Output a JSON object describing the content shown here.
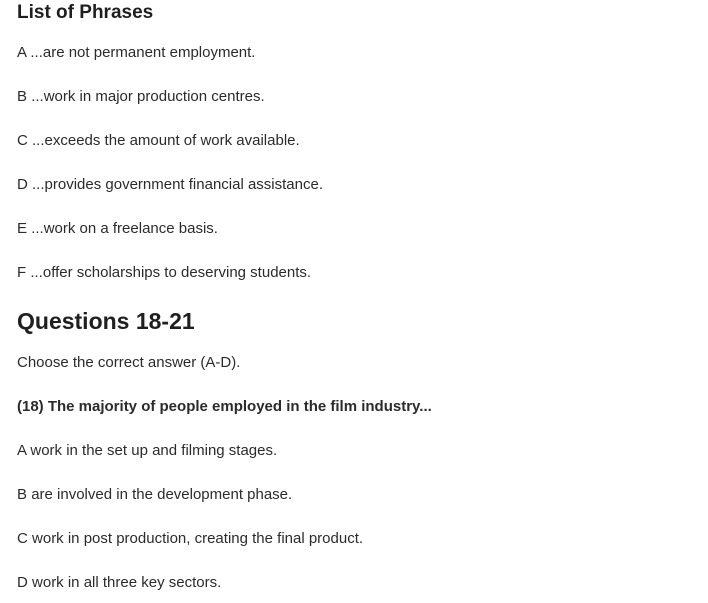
{
  "phrases": {
    "heading": "List of Phrases",
    "items": [
      {
        "letter": "A",
        "text": "...are not permanent employment."
      },
      {
        "letter": "B",
        "text": "...work in major production centres."
      },
      {
        "letter": "C",
        "text": "...exceeds the amount of work available."
      },
      {
        "letter": "D",
        "text": "...provides government financial assistance."
      },
      {
        "letter": "E",
        "text": "...work on a freelance basis."
      },
      {
        "letter": "F",
        "text": "...offer scholarships to deserving students."
      }
    ]
  },
  "questions": {
    "heading": "Questions 18-21",
    "instruction": "Choose the correct answer (A-D).",
    "question": "(18) The majority of people employed in the film industry...",
    "options": [
      {
        "letter": "A",
        "text": "work in the set up and filming stages."
      },
      {
        "letter": "B",
        "text": "are involved in the development phase."
      },
      {
        "letter": "C",
        "text": "work in post production, creating the final product."
      },
      {
        "letter": "D",
        "text": "work in all three key sectors."
      }
    ]
  }
}
